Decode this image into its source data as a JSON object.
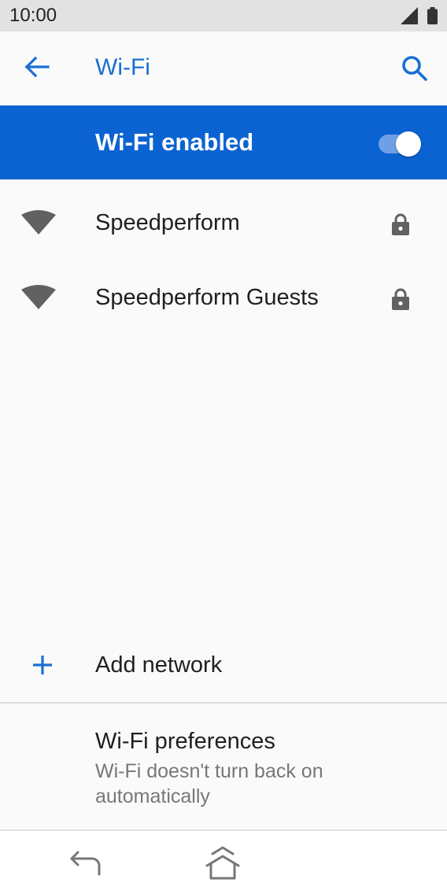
{
  "status_bar": {
    "time": "10:00",
    "signal_icon": "cell-signal-icon",
    "battery_icon": "battery-icon"
  },
  "app_bar": {
    "title": "Wi-Fi",
    "back_icon": "arrow-back-icon",
    "search_icon": "search-icon"
  },
  "master_switch": {
    "label": "Wi-Fi enabled",
    "enabled": true
  },
  "networks": [
    {
      "name": "Speedperform",
      "secured": true
    },
    {
      "name": "Speedperform Guests",
      "secured": true
    }
  ],
  "add_network": {
    "label": "Add network",
    "icon": "plus-icon"
  },
  "preferences": {
    "title": "Wi-Fi preferences",
    "summary": "Wi-Fi doesn't turn back on automatically"
  },
  "nav_bar": {
    "back_icon": "nav-back-icon",
    "home_icon": "nav-home-icon"
  },
  "colors": {
    "accent": "#1a6fd6",
    "master_bar": "#0b63d2",
    "icon_gray": "#616161",
    "background": "#fafafa"
  }
}
